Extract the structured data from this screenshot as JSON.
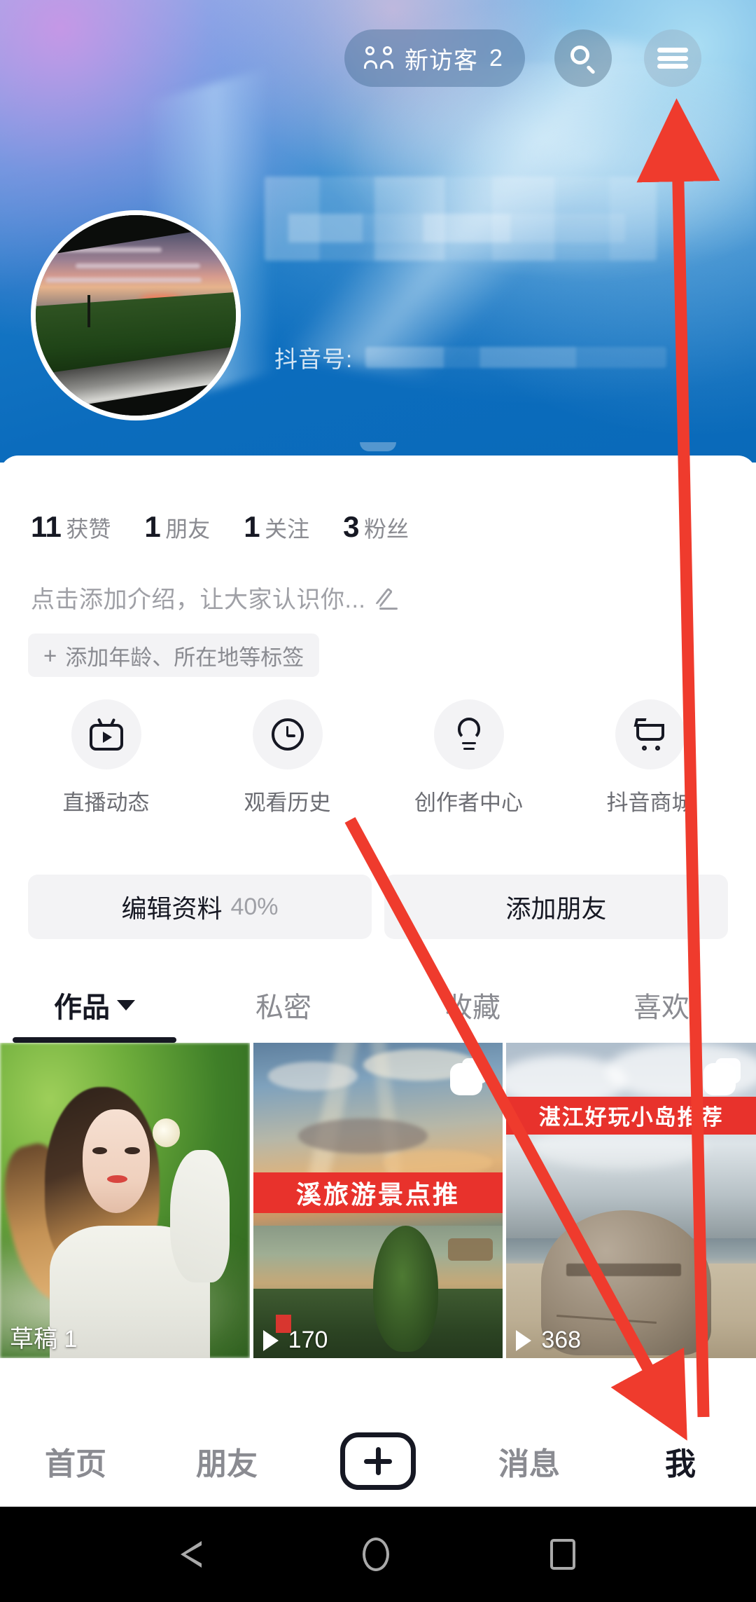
{
  "header": {
    "visitor_pill": {
      "label": "新访客",
      "count": "2",
      "icon": "people-icon"
    },
    "search_icon": "search-icon",
    "menu_icon": "hamburger-menu-icon"
  },
  "profile": {
    "nickname": "",
    "nickname_redacted": true,
    "douyin_id_label": "抖音号:",
    "douyin_id_value": "",
    "douyin_id_redacted": true,
    "avatar_alt": "sunset-field-photo"
  },
  "stats": [
    {
      "num": "11",
      "label": "获赞"
    },
    {
      "num": "1",
      "label": "朋友"
    },
    {
      "num": "1",
      "label": "关注"
    },
    {
      "num": "3",
      "label": "粉丝"
    }
  ],
  "bio": {
    "placeholder": "点击添加介绍，让大家认识你...",
    "edit_icon": "pencil-icon",
    "tag_button": {
      "plus": "+",
      "label": "添加年龄、所在地等标签"
    }
  },
  "quick_actions": [
    {
      "label": "直播动态",
      "icon": "tv-live-icon"
    },
    {
      "label": "观看历史",
      "icon": "clock-icon"
    },
    {
      "label": "创作者中心",
      "icon": "lightbulb-icon"
    },
    {
      "label": "抖音商城",
      "icon": "shopping-cart-icon"
    }
  ],
  "action_buttons": {
    "edit_profile": {
      "label": "编辑资料",
      "percent": "40%"
    },
    "add_friend": {
      "label": "添加朋友"
    }
  },
  "tabs": [
    {
      "label": "作品",
      "active": true,
      "has_caret": true
    },
    {
      "label": "私密",
      "active": false,
      "has_caret": false
    },
    {
      "label": "收藏",
      "active": false,
      "has_caret": false
    },
    {
      "label": "喜欢",
      "active": false,
      "has_caret": false
    }
  ],
  "grid": [
    {
      "meta": "草稿 1",
      "has_play_icon": false,
      "has_stack_icon": false,
      "banner": ""
    },
    {
      "meta": "170",
      "has_play_icon": true,
      "has_stack_icon": true,
      "banner": "溪旅游景点推"
    },
    {
      "meta": "368",
      "has_play_icon": true,
      "has_stack_icon": true,
      "banner": "湛江好玩小岛推荐"
    }
  ],
  "bottom_nav": [
    {
      "label": "首页",
      "active": false
    },
    {
      "label": "朋友",
      "active": false
    },
    {
      "label": "消息",
      "active": false
    },
    {
      "label": "我",
      "active": true
    }
  ],
  "bottom_nav_plus": {
    "icon": "plus-create-button"
  },
  "android_nav": [
    {
      "icon": "back-triangle-icon"
    },
    {
      "icon": "home-circle-icon"
    },
    {
      "icon": "recents-square-icon"
    }
  ],
  "annotation": {
    "color": "#ef3b2d",
    "arrows": [
      {
        "name": "arrow-to-menu-button",
        "from": [
          660,
          1390
        ],
        "to": [
          662,
          150
        ]
      },
      {
        "name": "arrow-to-me-tab",
        "from": [
          345,
          800
        ],
        "to": [
          660,
          1375
        ]
      }
    ]
  }
}
